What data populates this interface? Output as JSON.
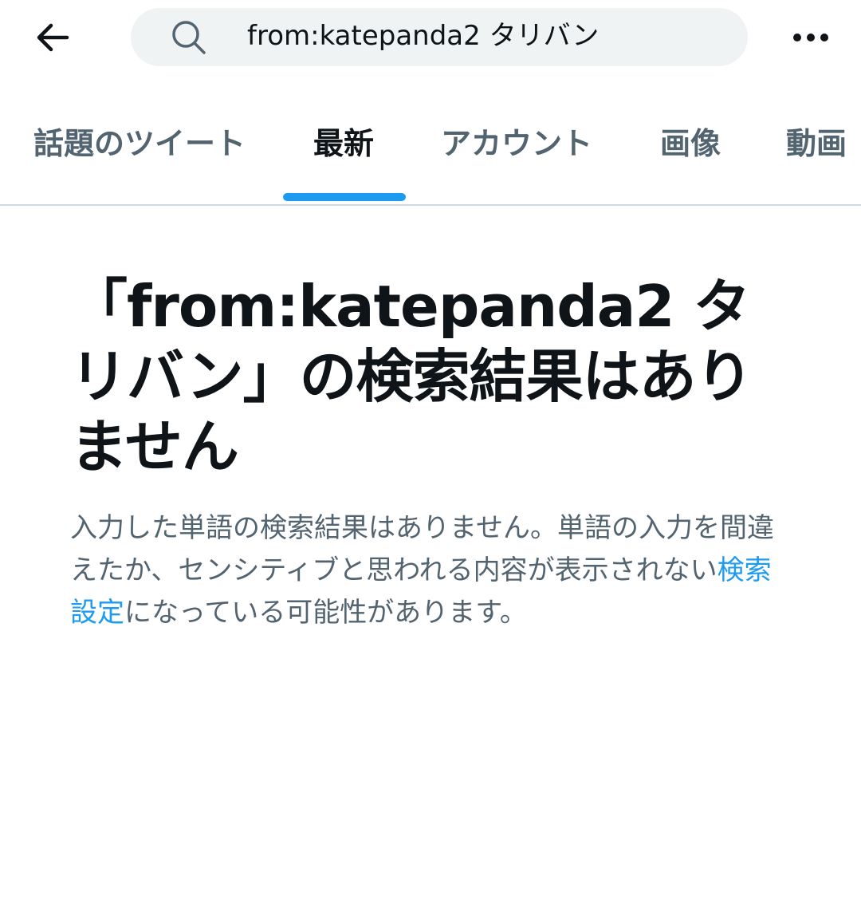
{
  "header": {
    "back_icon": "arrow-left-icon",
    "search": {
      "icon": "search-icon",
      "value": "from:katepanda2 タリバン"
    },
    "more_icon": "more-horizontal-icon"
  },
  "tabs": [
    {
      "label": "話題のツイート",
      "active": false
    },
    {
      "label": "最新",
      "active": true
    },
    {
      "label": "アカウント",
      "active": false
    },
    {
      "label": "画像",
      "active": false
    },
    {
      "label": "動画",
      "active": false
    }
  ],
  "empty_state": {
    "title": "「from:katepanda2 タリバン」の検索結果はありません",
    "body_prefix": "入力した単語の検索結果はありません。単語の入力を間違えたか、センシティブと思われる内容が表示されない",
    "body_link": "検索設定",
    "body_suffix": "になっている可能性があります。"
  },
  "colors": {
    "accent": "#1d9bf0",
    "text_primary": "#0f1419",
    "text_secondary": "#536471",
    "search_bg": "#eff3f4",
    "divider": "#cfd9de"
  }
}
